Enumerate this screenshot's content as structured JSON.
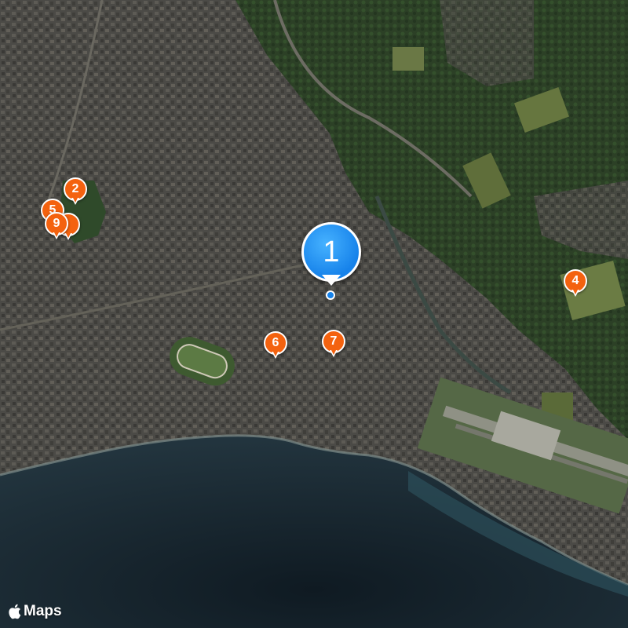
{
  "map": {
    "type": "satellite",
    "colors": {
      "sea": "#1f2e38",
      "land": "#4a4a44",
      "forest": "#2e4428",
      "field": "#5b6b3c"
    }
  },
  "markers": [
    {
      "label": "1",
      "type": "primary",
      "color": "#1a8cf0"
    },
    {
      "label": "2",
      "type": "secondary",
      "color": "#f4620f"
    },
    {
      "label": "4",
      "type": "secondary",
      "color": "#f4620f"
    },
    {
      "label": "5",
      "type": "secondary",
      "color": "#f4620f"
    },
    {
      "label": "9",
      "type": "secondary",
      "color": "#f4620f"
    },
    {
      "label": "6",
      "type": "secondary",
      "color": "#f4620f"
    },
    {
      "label": "7",
      "type": "secondary",
      "color": "#f4620f"
    }
  ],
  "attribution": {
    "logo_icon": "apple-logo-icon",
    "text": "Maps"
  }
}
